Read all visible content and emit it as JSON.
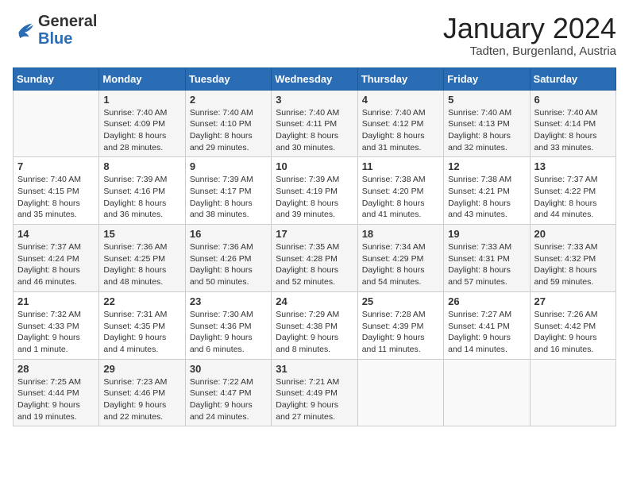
{
  "header": {
    "logo": {
      "general": "General",
      "blue": "Blue"
    },
    "title": "January 2024",
    "location": "Tadten, Burgenland, Austria"
  },
  "days_of_week": [
    "Sunday",
    "Monday",
    "Tuesday",
    "Wednesday",
    "Thursday",
    "Friday",
    "Saturday"
  ],
  "weeks": [
    [
      {
        "day": "",
        "sunrise": "",
        "sunset": "",
        "daylight": ""
      },
      {
        "day": "1",
        "sunrise": "Sunrise: 7:40 AM",
        "sunset": "Sunset: 4:09 PM",
        "daylight": "Daylight: 8 hours and 28 minutes."
      },
      {
        "day": "2",
        "sunrise": "Sunrise: 7:40 AM",
        "sunset": "Sunset: 4:10 PM",
        "daylight": "Daylight: 8 hours and 29 minutes."
      },
      {
        "day": "3",
        "sunrise": "Sunrise: 7:40 AM",
        "sunset": "Sunset: 4:11 PM",
        "daylight": "Daylight: 8 hours and 30 minutes."
      },
      {
        "day": "4",
        "sunrise": "Sunrise: 7:40 AM",
        "sunset": "Sunset: 4:12 PM",
        "daylight": "Daylight: 8 hours and 31 minutes."
      },
      {
        "day": "5",
        "sunrise": "Sunrise: 7:40 AM",
        "sunset": "Sunset: 4:13 PM",
        "daylight": "Daylight: 8 hours and 32 minutes."
      },
      {
        "day": "6",
        "sunrise": "Sunrise: 7:40 AM",
        "sunset": "Sunset: 4:14 PM",
        "daylight": "Daylight: 8 hours and 33 minutes."
      }
    ],
    [
      {
        "day": "7",
        "sunrise": "Sunrise: 7:40 AM",
        "sunset": "Sunset: 4:15 PM",
        "daylight": "Daylight: 8 hours and 35 minutes."
      },
      {
        "day": "8",
        "sunrise": "Sunrise: 7:39 AM",
        "sunset": "Sunset: 4:16 PM",
        "daylight": "Daylight: 8 hours and 36 minutes."
      },
      {
        "day": "9",
        "sunrise": "Sunrise: 7:39 AM",
        "sunset": "Sunset: 4:17 PM",
        "daylight": "Daylight: 8 hours and 38 minutes."
      },
      {
        "day": "10",
        "sunrise": "Sunrise: 7:39 AM",
        "sunset": "Sunset: 4:19 PM",
        "daylight": "Daylight: 8 hours and 39 minutes."
      },
      {
        "day": "11",
        "sunrise": "Sunrise: 7:38 AM",
        "sunset": "Sunset: 4:20 PM",
        "daylight": "Daylight: 8 hours and 41 minutes."
      },
      {
        "day": "12",
        "sunrise": "Sunrise: 7:38 AM",
        "sunset": "Sunset: 4:21 PM",
        "daylight": "Daylight: 8 hours and 43 minutes."
      },
      {
        "day": "13",
        "sunrise": "Sunrise: 7:37 AM",
        "sunset": "Sunset: 4:22 PM",
        "daylight": "Daylight: 8 hours and 44 minutes."
      }
    ],
    [
      {
        "day": "14",
        "sunrise": "Sunrise: 7:37 AM",
        "sunset": "Sunset: 4:24 PM",
        "daylight": "Daylight: 8 hours and 46 minutes."
      },
      {
        "day": "15",
        "sunrise": "Sunrise: 7:36 AM",
        "sunset": "Sunset: 4:25 PM",
        "daylight": "Daylight: 8 hours and 48 minutes."
      },
      {
        "day": "16",
        "sunrise": "Sunrise: 7:36 AM",
        "sunset": "Sunset: 4:26 PM",
        "daylight": "Daylight: 8 hours and 50 minutes."
      },
      {
        "day": "17",
        "sunrise": "Sunrise: 7:35 AM",
        "sunset": "Sunset: 4:28 PM",
        "daylight": "Daylight: 8 hours and 52 minutes."
      },
      {
        "day": "18",
        "sunrise": "Sunrise: 7:34 AM",
        "sunset": "Sunset: 4:29 PM",
        "daylight": "Daylight: 8 hours and 54 minutes."
      },
      {
        "day": "19",
        "sunrise": "Sunrise: 7:33 AM",
        "sunset": "Sunset: 4:31 PM",
        "daylight": "Daylight: 8 hours and 57 minutes."
      },
      {
        "day": "20",
        "sunrise": "Sunrise: 7:33 AM",
        "sunset": "Sunset: 4:32 PM",
        "daylight": "Daylight: 8 hours and 59 minutes."
      }
    ],
    [
      {
        "day": "21",
        "sunrise": "Sunrise: 7:32 AM",
        "sunset": "Sunset: 4:33 PM",
        "daylight": "Daylight: 9 hours and 1 minute."
      },
      {
        "day": "22",
        "sunrise": "Sunrise: 7:31 AM",
        "sunset": "Sunset: 4:35 PM",
        "daylight": "Daylight: 9 hours and 4 minutes."
      },
      {
        "day": "23",
        "sunrise": "Sunrise: 7:30 AM",
        "sunset": "Sunset: 4:36 PM",
        "daylight": "Daylight: 9 hours and 6 minutes."
      },
      {
        "day": "24",
        "sunrise": "Sunrise: 7:29 AM",
        "sunset": "Sunset: 4:38 PM",
        "daylight": "Daylight: 9 hours and 8 minutes."
      },
      {
        "day": "25",
        "sunrise": "Sunrise: 7:28 AM",
        "sunset": "Sunset: 4:39 PM",
        "daylight": "Daylight: 9 hours and 11 minutes."
      },
      {
        "day": "26",
        "sunrise": "Sunrise: 7:27 AM",
        "sunset": "Sunset: 4:41 PM",
        "daylight": "Daylight: 9 hours and 14 minutes."
      },
      {
        "day": "27",
        "sunrise": "Sunrise: 7:26 AM",
        "sunset": "Sunset: 4:42 PM",
        "daylight": "Daylight: 9 hours and 16 minutes."
      }
    ],
    [
      {
        "day": "28",
        "sunrise": "Sunrise: 7:25 AM",
        "sunset": "Sunset: 4:44 PM",
        "daylight": "Daylight: 9 hours and 19 minutes."
      },
      {
        "day": "29",
        "sunrise": "Sunrise: 7:23 AM",
        "sunset": "Sunset: 4:46 PM",
        "daylight": "Daylight: 9 hours and 22 minutes."
      },
      {
        "day": "30",
        "sunrise": "Sunrise: 7:22 AM",
        "sunset": "Sunset: 4:47 PM",
        "daylight": "Daylight: 9 hours and 24 minutes."
      },
      {
        "day": "31",
        "sunrise": "Sunrise: 7:21 AM",
        "sunset": "Sunset: 4:49 PM",
        "daylight": "Daylight: 9 hours and 27 minutes."
      },
      {
        "day": "",
        "sunrise": "",
        "sunset": "",
        "daylight": ""
      },
      {
        "day": "",
        "sunrise": "",
        "sunset": "",
        "daylight": ""
      },
      {
        "day": "",
        "sunrise": "",
        "sunset": "",
        "daylight": ""
      }
    ]
  ]
}
